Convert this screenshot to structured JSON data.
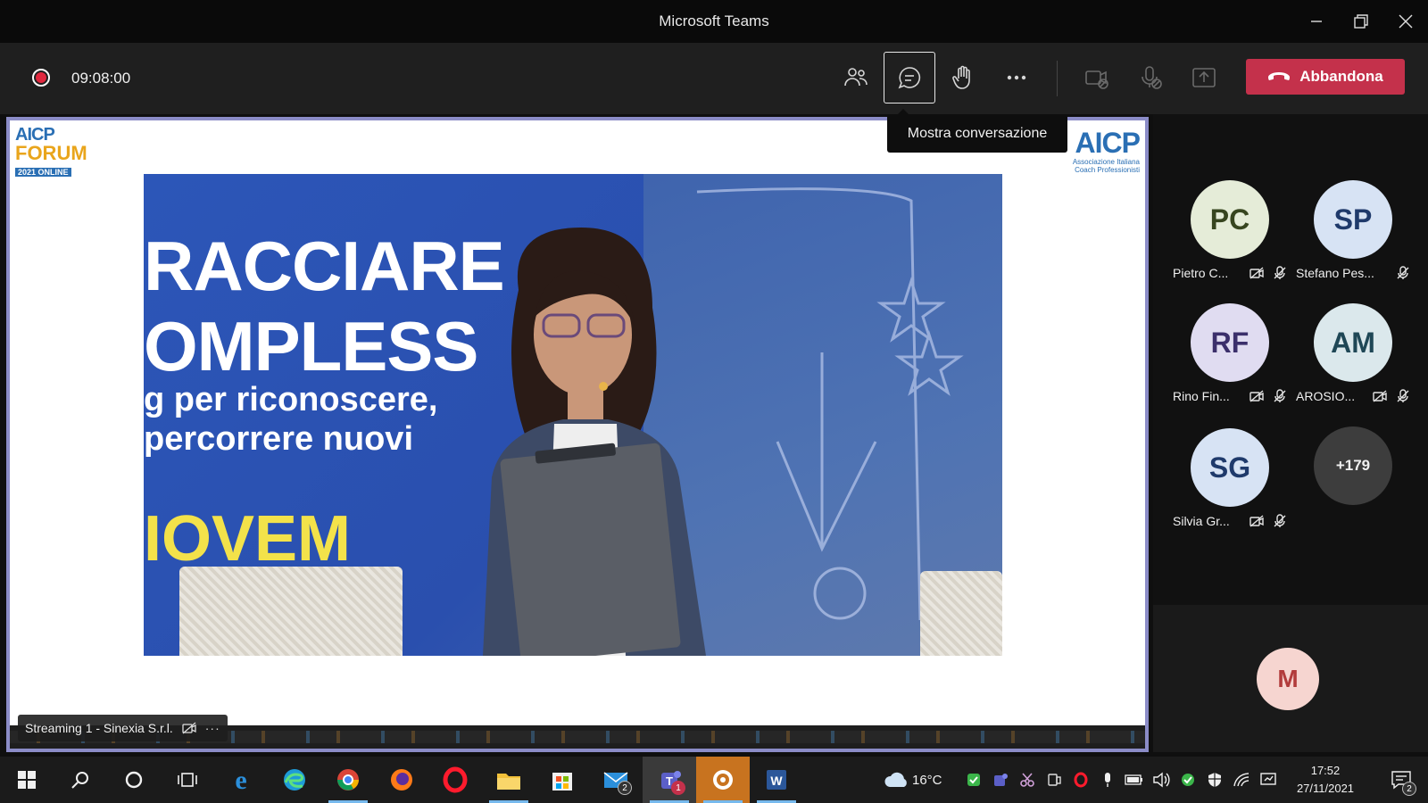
{
  "window": {
    "title": "Microsoft Teams"
  },
  "meeting": {
    "timer": "09:08:00",
    "leave_label": "Abbandona",
    "tooltip": "Mostra conversazione"
  },
  "stage": {
    "logo_left": {
      "line1": "AICP",
      "line2": "FORUM",
      "line3": "2021 ONLINE"
    },
    "logo_right": {
      "line1": "AICP",
      "line2": "Associazione Italiana",
      "line3": "Coach Professionisti"
    },
    "slide": {
      "line1": "RACCIARE",
      "line2": "OMPLESS",
      "line3": "g per riconoscere,",
      "line4": "percorrere nuovi",
      "line5": "IOVEM"
    },
    "name_tag": "Streaming 1 - Sinexia S.r.l.",
    "name_tag_more": "···"
  },
  "participants": [
    {
      "initials": "PC",
      "name": "Pietro C...",
      "bg": "#e5ecd8",
      "fg": "#37451f"
    },
    {
      "initials": "SP",
      "name": "Stefano Pes...",
      "bg": "#d7e3f4",
      "fg": "#1f3a6b"
    },
    {
      "initials": "RF",
      "name": "Rino Fin...",
      "bg": "#e0dcf1",
      "fg": "#3b2f6b"
    },
    {
      "initials": "AM",
      "name": "AROSIO...",
      "bg": "#dbe8ec",
      "fg": "#1f4756"
    },
    {
      "initials": "SG",
      "name": "Silvia Gr...",
      "bg": "#d7e3f4",
      "fg": "#1f3a6b"
    }
  ],
  "more_participants": "+179",
  "self_avatar": "M",
  "taskbar": {
    "temperature": "16°C",
    "time": "17:52",
    "date": "27/11/2021",
    "mail_badge": "2",
    "teams_badge": "1",
    "notif_badge": "2"
  }
}
